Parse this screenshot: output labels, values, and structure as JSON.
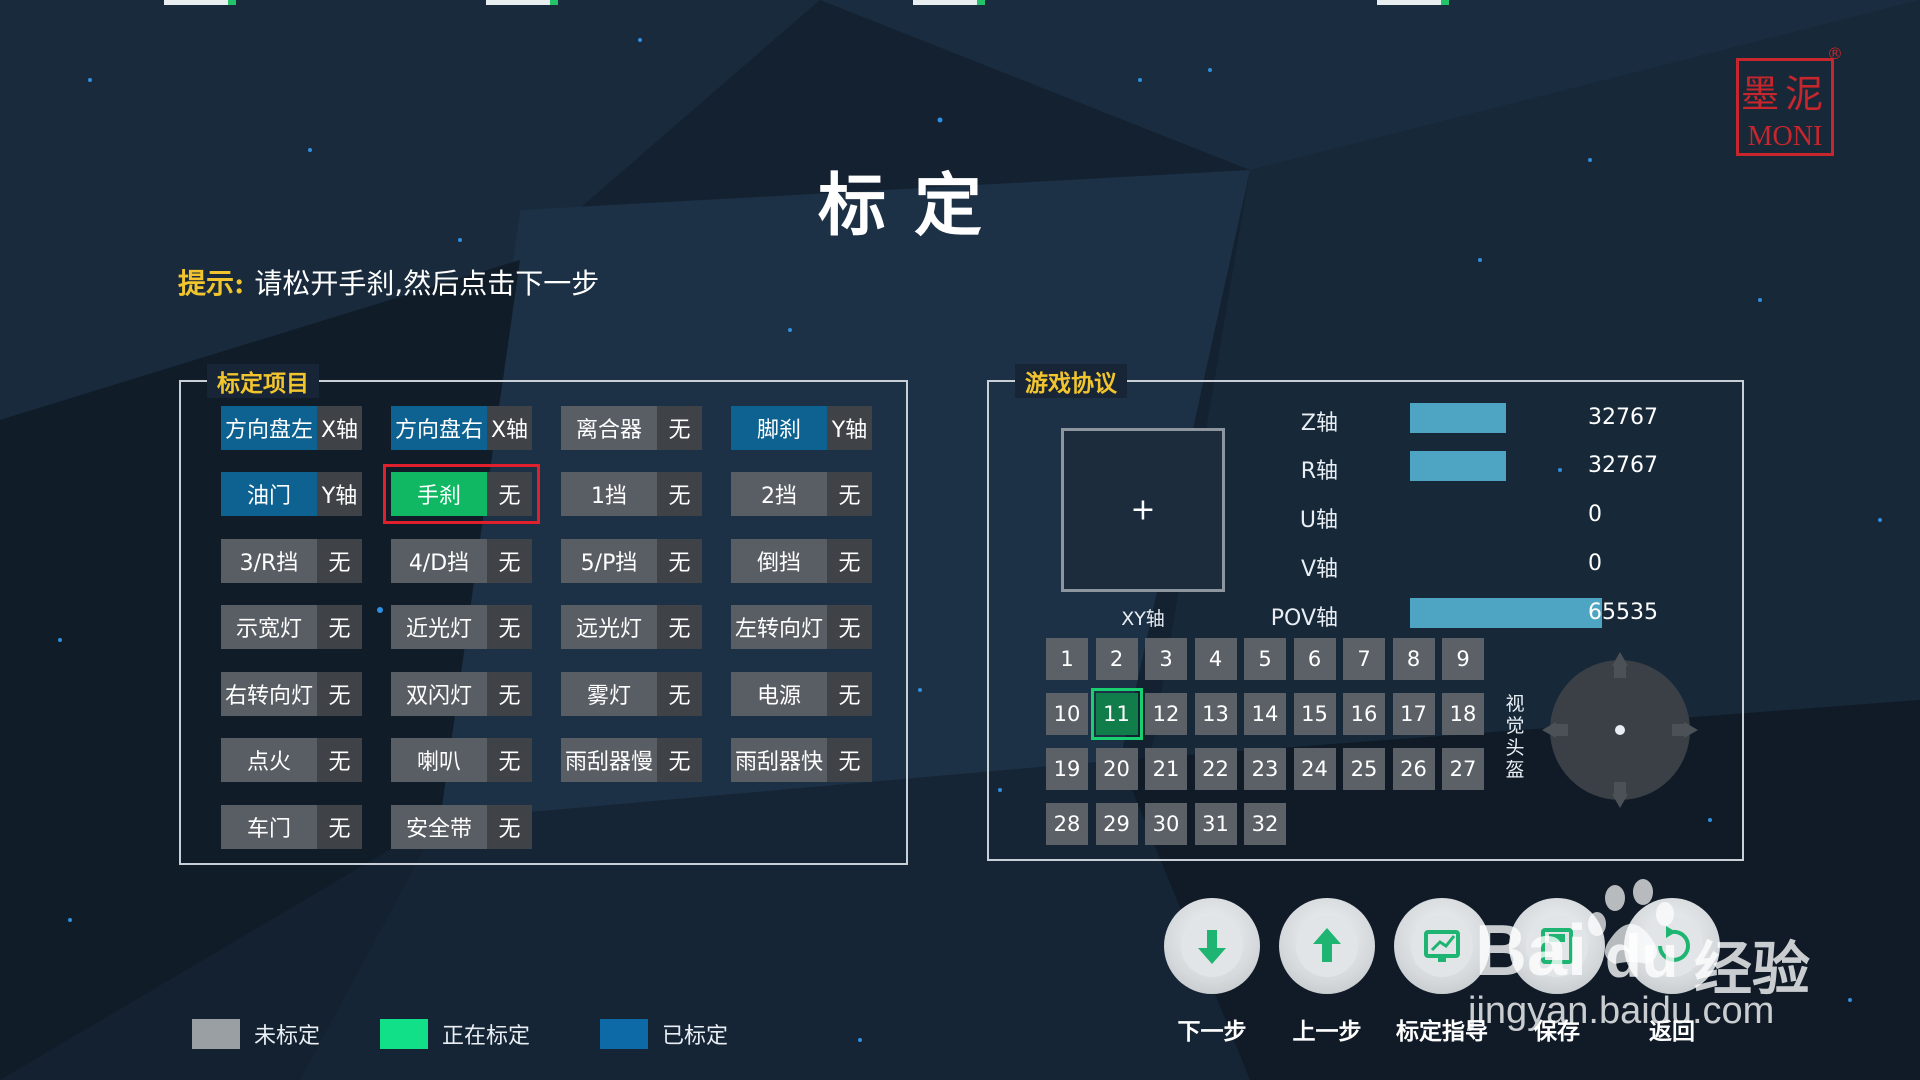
{
  "title": "标定",
  "hint": {
    "label": "提示:",
    "text": "请松开手刹,然后点击下一步"
  },
  "calibration_panel": {
    "title": "标定项目",
    "items": [
      {
        "name": "方向盘左",
        "axis": "X轴",
        "state": "blue"
      },
      {
        "name": "方向盘右",
        "axis": "X轴",
        "state": "blue"
      },
      {
        "name": "离合器",
        "axis": "无",
        "state": "grey"
      },
      {
        "name": "脚刹",
        "axis": "Y轴",
        "state": "blue"
      },
      {
        "name": "油门",
        "axis": "Y轴",
        "state": "blue"
      },
      {
        "name": "手刹",
        "axis": "无",
        "state": "green",
        "selected": true
      },
      {
        "name": "1挡",
        "axis": "无",
        "state": "grey"
      },
      {
        "name": "2挡",
        "axis": "无",
        "state": "grey"
      },
      {
        "name": "3/R挡",
        "axis": "无",
        "state": "grey"
      },
      {
        "name": "4/D挡",
        "axis": "无",
        "state": "grey"
      },
      {
        "name": "5/P挡",
        "axis": "无",
        "state": "grey"
      },
      {
        "name": "倒挡",
        "axis": "无",
        "state": "grey"
      },
      {
        "name": "示宽灯",
        "axis": "无",
        "state": "grey"
      },
      {
        "name": "近光灯",
        "axis": "无",
        "state": "grey"
      },
      {
        "name": "远光灯",
        "axis": "无",
        "state": "grey"
      },
      {
        "name": "左转向灯",
        "axis": "无",
        "state": "grey"
      },
      {
        "name": "右转向灯",
        "axis": "无",
        "state": "grey"
      },
      {
        "name": "双闪灯",
        "axis": "无",
        "state": "grey"
      },
      {
        "name": "雾灯",
        "axis": "无",
        "state": "grey"
      },
      {
        "name": "电源",
        "axis": "无",
        "state": "grey"
      },
      {
        "name": "点火",
        "axis": "无",
        "state": "grey"
      },
      {
        "name": "喇叭",
        "axis": "无",
        "state": "grey"
      },
      {
        "name": "雨刮器慢",
        "axis": "无",
        "state": "grey"
      },
      {
        "name": "雨刮器快",
        "axis": "无",
        "state": "grey"
      },
      {
        "name": "车门",
        "axis": "无",
        "state": "grey"
      },
      {
        "name": "安全带",
        "axis": "无",
        "state": "grey"
      }
    ]
  },
  "game_panel": {
    "title": "游戏协议",
    "xy_label": "XY轴",
    "xy_symbol": "+",
    "axes": [
      {
        "name": "Z轴",
        "value": "32767",
        "level": 0.5
      },
      {
        "name": "R轴",
        "value": "32767",
        "level": 0.5
      },
      {
        "name": "U轴",
        "value": "0",
        "level": 0
      },
      {
        "name": "V轴",
        "value": "0",
        "level": 0
      },
      {
        "name": "POV轴",
        "value": "65535",
        "level": 1.0
      }
    ],
    "buttons": [
      "1",
      "2",
      "3",
      "4",
      "5",
      "6",
      "7",
      "8",
      "9",
      "10",
      "11",
      "12",
      "13",
      "14",
      "15",
      "16",
      "17",
      "18",
      "19",
      "20",
      "21",
      "22",
      "23",
      "24",
      "25",
      "26",
      "27",
      "28",
      "29",
      "30",
      "31",
      "32"
    ],
    "active_button": "11",
    "pov_label": "视觉头盔"
  },
  "legend": [
    {
      "label": "未标定",
      "color": "#9a9fa4"
    },
    {
      "label": "正在标定",
      "color": "#12e088"
    },
    {
      "label": "已标定",
      "color": "#0d6aa6"
    }
  ],
  "actions": [
    {
      "label": "下一步",
      "icon": "arrow-down-icon"
    },
    {
      "label": "上一步",
      "icon": "arrow-up-icon"
    },
    {
      "label": "标定指导",
      "icon": "guide-icon"
    },
    {
      "label": "保存",
      "icon": "save-icon"
    },
    {
      "label": "返回",
      "icon": "return-icon"
    }
  ],
  "logo": {
    "cn": "墨泥",
    "en": "MONI",
    "reg": "®"
  },
  "watermark": {
    "brand": "Bai",
    "du": "du",
    "jy": "经验",
    "url": "jingyan.baidu.com"
  },
  "colors": {
    "accent_yellow": "#f2c52e",
    "selected_red": "#e0202c",
    "logo_red": "#c6262c",
    "bar_blue": "#4ea5c3"
  }
}
